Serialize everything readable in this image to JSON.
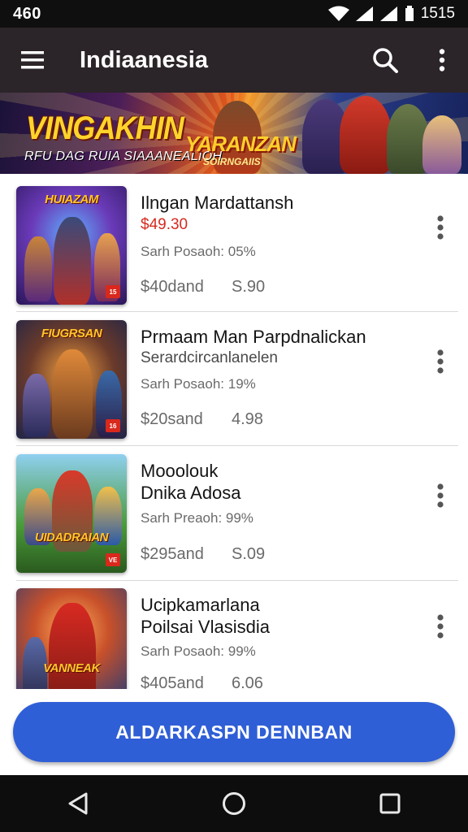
{
  "status_bar": {
    "time": "460",
    "clock": "1515"
  },
  "app_bar": {
    "title": "Indiaanesia"
  },
  "banner": {
    "headline": "VINGAKHIN",
    "subline": "RFU DAG RUIA SIAAANEALIOH",
    "logo_main": "YARANZAN",
    "logo_sub": "SOIRNGAIIS"
  },
  "games": [
    {
      "thumb_title": "HUIAZAM",
      "thumb_badge": "15",
      "title": "Ilngan Mardattansh",
      "subtitle": "",
      "price_red": "$49.30",
      "info": "Sarh Posaoh: 05%",
      "price": "$40dand",
      "rating": "S.90"
    },
    {
      "thumb_title": "FIUGRSAN",
      "thumb_badge": "16",
      "title": "Prmaam Man Parpdnalickan",
      "subtitle": "Serardcircanlanelen",
      "price_red": "",
      "info": "Sarh Posaoh: 19%",
      "price": "$20sand",
      "rating": "4.98"
    },
    {
      "thumb_title": "UIDADRAIAN",
      "thumb_badge": "VE",
      "title": "Mooolouk Dnika Adosa",
      "subtitle": "",
      "price_red": "",
      "info": "Sarh Preaoh: 99%",
      "price": "$295and",
      "rating": "S.09"
    },
    {
      "thumb_title": "VANNEAK",
      "thumb_badge": "",
      "title": "Ucipkamarlana Poilsai Vlasisdia",
      "subtitle": "",
      "price_red": "",
      "info": "Sarh Posaoh: 99%",
      "price": "$405and",
      "rating": "6.06"
    }
  ],
  "action_button": {
    "label": "ALDARKASPN  DENNBAN"
  },
  "colors": {
    "app_bar": "#2b2428",
    "action_button": "#2f5fd6",
    "price_red": "#d52a1f",
    "nav_bar": "#0d0d0d"
  },
  "icons": {
    "status": [
      "wifi-icon",
      "signal-icon",
      "battery-icon"
    ],
    "app_bar": [
      "menu-icon",
      "search-icon",
      "more-vert-icon"
    ],
    "nav": [
      "back-icon",
      "home-icon",
      "recents-icon"
    ]
  }
}
